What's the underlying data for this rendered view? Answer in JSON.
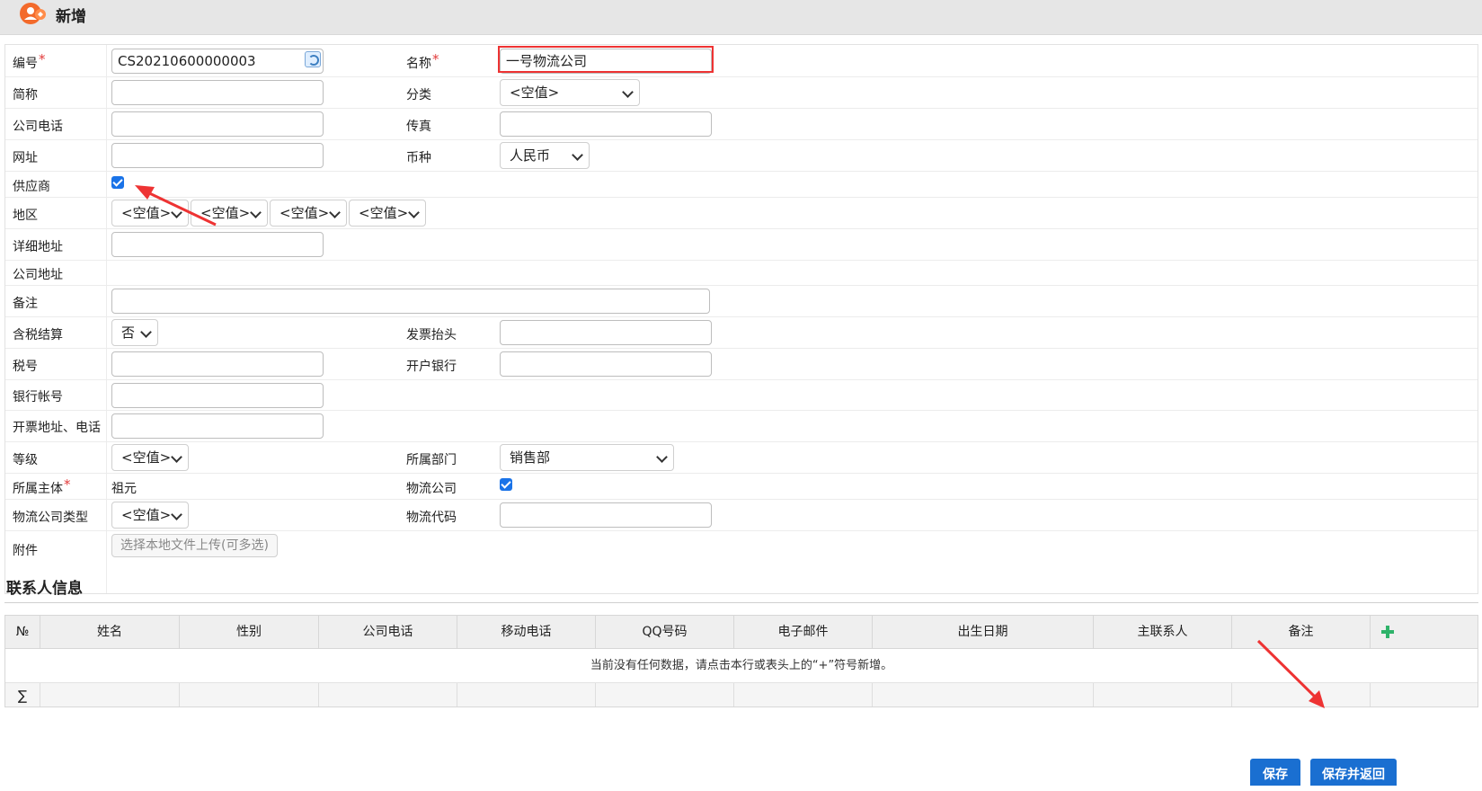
{
  "header": {
    "title": "新增"
  },
  "form": {
    "code_label": "编号",
    "code_value": "CS20210600000003",
    "name_label": "名称",
    "name_value": "一号物流公司",
    "short_label": "简称",
    "category_label": "分类",
    "category_value": "<空值>",
    "phone_label": "公司电话",
    "fax_label": "传真",
    "website_label": "网址",
    "currency_label": "币种",
    "currency_value": "人民币",
    "supplier_label": "供应商",
    "supplier_checked": true,
    "region_label": "地区",
    "region_values": [
      "<空值>",
      "<空值>",
      "<空值>",
      "<空值>"
    ],
    "detail_address_label": "详细地址",
    "company_address_label": "公司地址",
    "remark_label": "备注",
    "tax_included_label": "含税结算",
    "tax_included_value": "否",
    "invoice_title_label": "发票抬头",
    "tax_no_label": "税号",
    "bank_label": "开户银行",
    "account_label": "银行帐号",
    "invoice_addr_label": "开票地址、电话",
    "level_label": "等级",
    "level_value": "<空值>",
    "dept_label": "所属部门",
    "dept_value": "销售部",
    "owner_label": "所属主体",
    "owner_value": "祖元",
    "logistics_label": "物流公司",
    "logistics_checked": true,
    "logistics_type_label": "物流公司类型",
    "logistics_type_value": "<空值>",
    "logistics_code_label": "物流代码",
    "attachment_label": "附件",
    "upload_label": "选择本地文件上传(可多选)"
  },
  "contacts": {
    "title": "联系人信息",
    "columns": [
      "№",
      "姓名",
      "性别",
      "公司电话",
      "移动电话",
      "QQ号码",
      "电子邮件",
      "出生日期",
      "主联系人",
      "备注"
    ],
    "empty_text": "当前没有任何数据，请点击本行或表头上的“+”符号新增。",
    "sum_symbol": "∑"
  },
  "buttons": {
    "save": "保存",
    "save_return": "保存并返回"
  },
  "colors": {
    "accent": "#1a6fd1",
    "required": "#e23b3b",
    "highlight": "#e33333",
    "add_icon": "#2fb36a"
  }
}
